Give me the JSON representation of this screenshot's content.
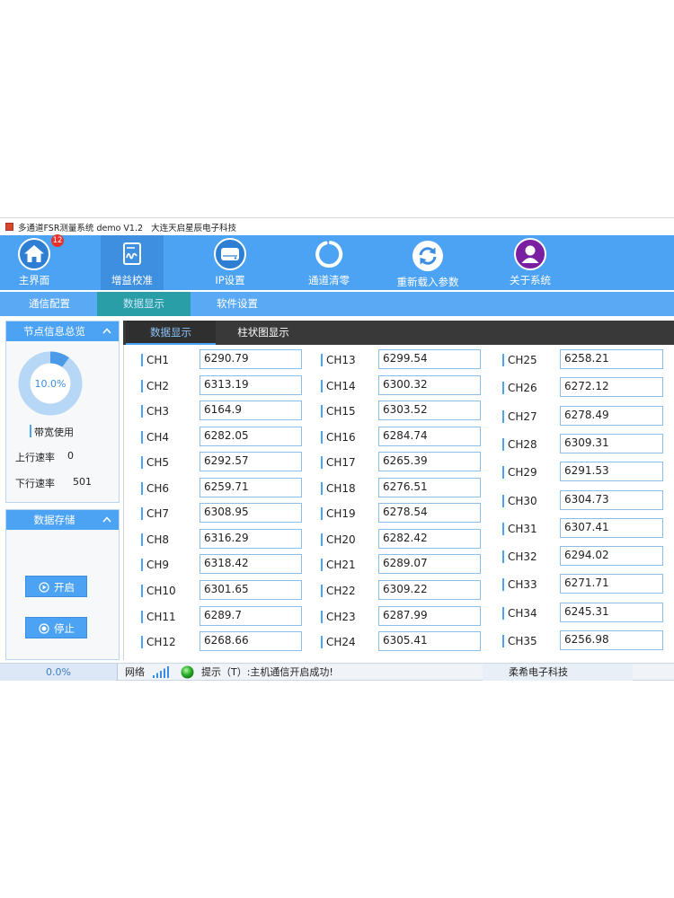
{
  "colors": {
    "primary": "#4da3f3",
    "selected": "#3f8fe0",
    "subnav": "#5aa9f5",
    "teal": "#2a9ea6",
    "tab_bar": "#393939",
    "about_purple": "#7b1fa2",
    "badge_red": "#e8312c",
    "status_green": "#2fb52f"
  },
  "window": {
    "title": "多通道FSR测量系统 demo V1.2",
    "company": "大连天启星辰电子科技"
  },
  "toolbar": {
    "items": [
      {
        "label": "主界面",
        "icon": "home-icon",
        "badge": "12"
      },
      {
        "label": "增益校准",
        "icon": "signature-document-icon",
        "selected": true
      },
      {
        "label": "IP设置",
        "icon": "drive-icon"
      },
      {
        "label": "通道清零",
        "icon": "ring-icon"
      },
      {
        "label": "重新载入参数",
        "icon": "refresh-icon"
      },
      {
        "label": "关于系统",
        "icon": "user-icon"
      }
    ]
  },
  "subnav": {
    "items": [
      {
        "label": "通信配置"
      },
      {
        "label": "数据显示",
        "selected": true
      },
      {
        "label": "软件设置"
      }
    ]
  },
  "node_panel": {
    "title": "节点信息总览",
    "bandwidth_usage": 10.0,
    "bandwidth_text": "10.0%",
    "bandwidth_label": "带宽使用",
    "up_label": "上行速率",
    "up_value": "0",
    "down_label": "下行速率",
    "down_value": "501"
  },
  "storage_panel": {
    "title": "数据存储",
    "start_label": "开启",
    "stop_label": "停止"
  },
  "data_tabs": [
    {
      "label": "数据显示",
      "selected": true
    },
    {
      "label": "柱状图显示"
    }
  ],
  "channels": {
    "columns": [
      [
        {
          "label": "CH1",
          "value": "6290.79"
        },
        {
          "label": "CH2",
          "value": "6313.19"
        },
        {
          "label": "CH3",
          "value": "6164.9"
        },
        {
          "label": "CH4",
          "value": "6282.05"
        },
        {
          "label": "CH5",
          "value": "6292.57"
        },
        {
          "label": "CH6",
          "value": "6259.71"
        },
        {
          "label": "CH7",
          "value": "6308.95"
        },
        {
          "label": "CH8",
          "value": "6316.29"
        },
        {
          "label": "CH9",
          "value": "6318.42"
        },
        {
          "label": "CH10",
          "value": "6301.65"
        },
        {
          "label": "CH11",
          "value": "6289.7"
        },
        {
          "label": "CH12",
          "value": "6268.66"
        }
      ],
      [
        {
          "label": "CH13",
          "value": "6299.54"
        },
        {
          "label": "CH14",
          "value": "6300.32"
        },
        {
          "label": "CH15",
          "value": "6303.52"
        },
        {
          "label": "CH16",
          "value": "6284.74"
        },
        {
          "label": "CH17",
          "value": "6265.39"
        },
        {
          "label": "CH18",
          "value": "6276.51"
        },
        {
          "label": "CH19",
          "value": "6278.54"
        },
        {
          "label": "CH20",
          "value": "6282.42"
        },
        {
          "label": "CH21",
          "value": "6289.07"
        },
        {
          "label": "CH22",
          "value": "6309.22"
        },
        {
          "label": "CH23",
          "value": "6287.99"
        },
        {
          "label": "CH24",
          "value": "6305.41"
        }
      ],
      [
        {
          "label": "CH25",
          "value": "6258.21"
        },
        {
          "label": "CH26",
          "value": "6272.12"
        },
        {
          "label": "CH27",
          "value": "6278.49"
        },
        {
          "label": "CH28",
          "value": "6309.31"
        },
        {
          "label": "CH29",
          "value": "6291.53"
        },
        {
          "label": "CH30",
          "value": "6304.73"
        },
        {
          "label": "CH31",
          "value": "6307.41"
        },
        {
          "label": "CH32",
          "value": "6294.02"
        },
        {
          "label": "CH33",
          "value": "6271.71"
        },
        {
          "label": "CH34",
          "value": "6245.31"
        },
        {
          "label": "CH35",
          "value": "6256.98"
        }
      ]
    ]
  },
  "status": {
    "progress": "0.0%",
    "network_label": "网络",
    "tip": "提示（T）:主机通信开启成功!",
    "company": "柔希电子科技"
  }
}
